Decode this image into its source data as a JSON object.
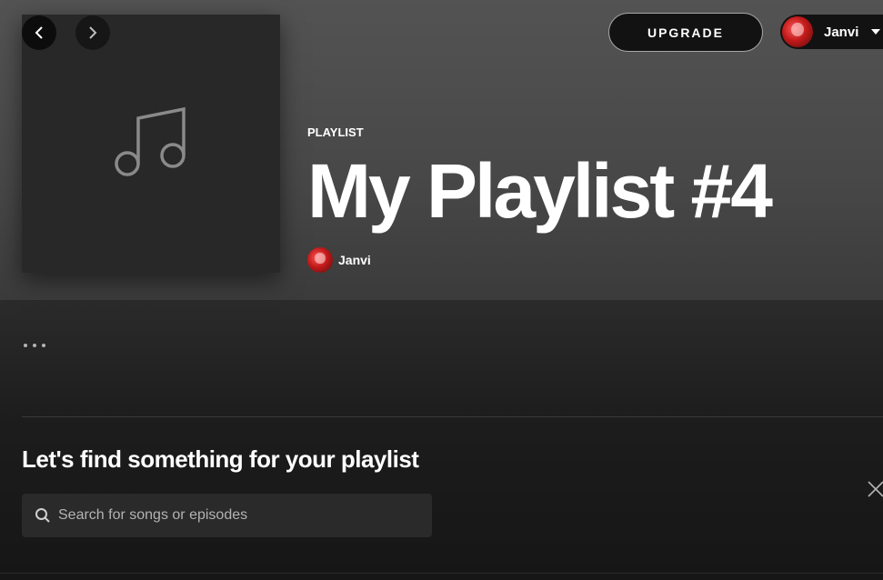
{
  "header": {
    "upgrade_label": "UPGRADE",
    "user_name": "Janvi",
    "icons": {
      "back": "chevron-left-icon",
      "forward": "chevron-right-icon",
      "user_caret": "caret-down-icon"
    }
  },
  "playlist": {
    "type_label": "PLAYLIST",
    "title": "My Playlist #4",
    "owner_name": "Janvi",
    "cover_icon": "music-note-icon",
    "more_icon": "more-options-icon"
  },
  "finder": {
    "heading": "Let's find something for your playlist",
    "search_placeholder": "Search for songs or episodes",
    "search_value": "",
    "close_icon": "close-icon"
  },
  "colors": {
    "background": "#121212",
    "header_gradient_top": "#535353",
    "text_primary": "#ffffff",
    "text_secondary": "#b3b3b3",
    "search_bg": "#2a2a2a"
  }
}
